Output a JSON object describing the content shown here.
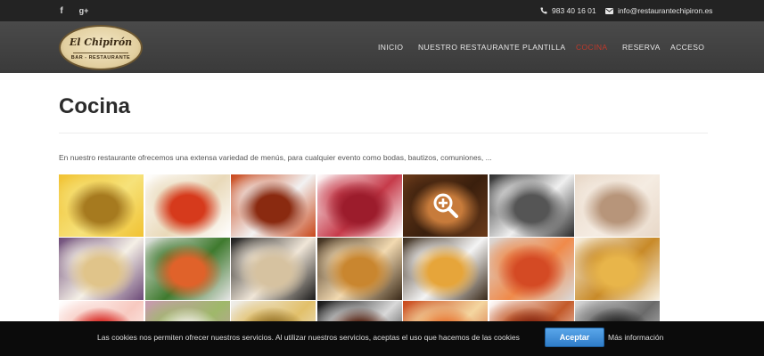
{
  "topbar": {
    "facebook_glyph": "f",
    "googleplus_glyph": "g+",
    "phone": "983 40 16 01",
    "email": "info@restaurantechipiron.es",
    "phone_icon": "phone-icon",
    "email_icon": "envelope-icon"
  },
  "header": {
    "logo": {
      "name": "El Chipirón",
      "subtitle": "BAR - RESTAURANTE"
    },
    "nav": [
      "INICIO",
      "NUESTRO RESTAURANTE",
      "PLANTILLA",
      "COCINA",
      "RESERVA",
      "ACCESO"
    ],
    "active_nav": "COCINA",
    "active_color": "#c0392b"
  },
  "page": {
    "title": "Cocina",
    "intro": "En nuestro restaurante ofrecemos una extensa variedad de menús, para cualquier evento como bodas, bautizos, comuniones, ..."
  },
  "gallery": {
    "hover_icon": "zoom-in-icon",
    "photos": [
      {
        "subject": "lasagna with sauce",
        "colors": [
          "#f1c232",
          "#a67a1f",
          "#f6e27a"
        ]
      },
      {
        "subject": "fish with tomato",
        "colors": [
          "#ffffff",
          "#d63a1c",
          "#e9d9b9"
        ]
      },
      {
        "subject": "seafood soup",
        "colors": [
          "#c9471a",
          "#8a2a10",
          "#f2f2f2"
        ]
      },
      {
        "subject": "cured ham",
        "colors": [
          "#ffffff",
          "#9c1c2c",
          "#c63b4a"
        ]
      },
      {
        "subject": "roast meat",
        "colors": [
          "#6a3a1a",
          "#c77b3b",
          "#3a1f0d"
        ]
      },
      {
        "subject": "squid in ink",
        "colors": [
          "#2b2b2b",
          "#555555",
          "#f0f0f0"
        ]
      },
      {
        "subject": "stuffed squid",
        "colors": [
          "#e8d8c8",
          "#b7957a",
          "#f5ece2"
        ]
      },
      {
        "subject": "dumplings plate",
        "colors": [
          "#6c4a78",
          "#e0c48a",
          "#f5f0e6"
        ]
      },
      {
        "subject": "grilled fish",
        "colors": [
          "#e5e5e5",
          "#e0622a",
          "#3f7a2e"
        ]
      },
      {
        "subject": "canapes",
        "colors": [
          "#1a1a1a",
          "#d6c2a0",
          "#f0e6d8"
        ]
      },
      {
        "subject": "croqueta",
        "colors": [
          "#3a2a1a",
          "#c9862f",
          "#f2d9b0"
        ]
      },
      {
        "subject": "coffee and pastry",
        "colors": [
          "#3a2a1a",
          "#e6a53a",
          "#f4f4f4"
        ]
      },
      {
        "subject": "tomato dish",
        "colors": [
          "#d9d9d9",
          "#d44a24",
          "#f08a4a"
        ]
      },
      {
        "subject": "toasts",
        "colors": [
          "#f7f0e2",
          "#e8b54a",
          "#c88a28"
        ]
      },
      {
        "subject": "tomato salad",
        "colors": [
          "#ffffff",
          "#d9302a",
          "#f7c9c0"
        ]
      },
      {
        "subject": "salad",
        "colors": [
          "#c89ab0",
          "#e6e6d6",
          "#9fb86a"
        ]
      },
      {
        "subject": "stew",
        "colors": [
          "#efefef",
          "#9c7a2f",
          "#e2c06a"
        ]
      },
      {
        "subject": "meat dish",
        "colors": [
          "#0f0f0f",
          "#5a2a1a",
          "#d9d9d9"
        ]
      },
      {
        "subject": "paella",
        "colors": [
          "#c9471a",
          "#e87c3a",
          "#f4d6a0"
        ]
      },
      {
        "subject": "grilled sausages",
        "colors": [
          "#ffffff",
          "#8a2a12",
          "#c35a2a"
        ]
      },
      {
        "subject": "black rice",
        "colors": [
          "#d9d9d9",
          "#2a2a2a",
          "#6a6a6a"
        ]
      }
    ]
  },
  "cookie": {
    "message": "Las cookies nos permiten ofrecer nuestros servicios. Al utilizar nuestros servicios, aceptas el uso que hacemos de las cookies",
    "accept": "Aceptar",
    "more_info": "Más información"
  }
}
